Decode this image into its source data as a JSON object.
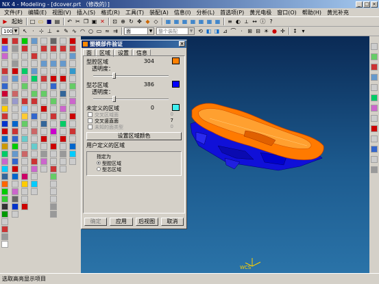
{
  "window": {
    "title": "NX 4 - Modeling - [dcover.prt （修改的）]"
  },
  "menu": [
    "文件(F)",
    "编辑(E)",
    "视图(V)",
    "插入(S)",
    "格式(R)",
    "工具(T)",
    "装配(A)",
    "信息(I)",
    "分析(L)",
    "首选项(P)",
    "黄光电极",
    "窗口(O)",
    "帮助(H)",
    "黄光补充"
  ],
  "toolbar": {
    "start_label": "起始",
    "face_filter": "面",
    "assembly_filter": "整个装配",
    "zoom_value": "100"
  },
  "dialog": {
    "title": "塑模部件验证",
    "tabs": [
      "面",
      "区域",
      "设置",
      "信息"
    ],
    "active_tab": "区域",
    "cavity_label": "型腔区域",
    "cavity_count": "304",
    "cavity_color": "#ff8000",
    "transparency_label": "透明度：",
    "core_label": "型芯区域",
    "core_count": "386",
    "core_color": "#0000ff",
    "undefined_label": "未定义的区域",
    "undefined_count": "0",
    "undefined_color": "#40f0f0",
    "cross_face_label": "交叉区域面",
    "cross_face_count": "0",
    "cross_vertical_label": "交叉竖直面",
    "cross_vertical_count": "7",
    "unknown_label": "未知的面类型",
    "unknown_count": "0",
    "set_color_button": "设置区域颜色",
    "user_group_label": "用户定义的区域",
    "assign_label": "指定为",
    "radio_cavity": "型腔区域",
    "radio_core": "型芯区域",
    "buttons": {
      "ok": "确定",
      "apply": "应用",
      "back": "后视图",
      "cancel": "取消"
    }
  },
  "status": {
    "message": "选取高亮显示项目"
  },
  "viewport": {
    "wcs_label": "WCS"
  }
}
